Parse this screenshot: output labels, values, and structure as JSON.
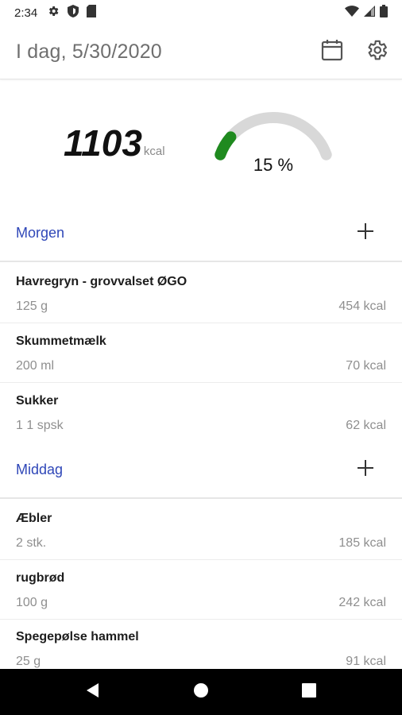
{
  "status_bar": {
    "time": "2:34",
    "left_icons": [
      "gear-icon",
      "shield-icon",
      "sd-card-icon"
    ],
    "right_icons": [
      "wifi-icon",
      "signal-icon",
      "battery-icon"
    ]
  },
  "app_bar": {
    "title": "I dag, 5/30/2020",
    "actions": [
      "calendar-icon",
      "settings-icon"
    ]
  },
  "summary": {
    "kcal_value": "1103",
    "kcal_unit": "kcal",
    "progress_label": "15 %",
    "progress_fraction": 0.15,
    "colors": {
      "progress": "#1f8a1f",
      "track": "#d8d8d8"
    }
  },
  "meals": [
    {
      "name": "Morgen",
      "items": [
        {
          "name": "Havregryn - grovvalset ØGO",
          "amount": "125 g",
          "kcal": "454 kcal"
        },
        {
          "name": "Skummetmælk",
          "amount": "200 ml",
          "kcal": "70 kcal"
        },
        {
          "name": "Sukker",
          "amount": "1 1 spsk",
          "kcal": "62 kcal"
        }
      ]
    },
    {
      "name": "Middag",
      "items": [
        {
          "name": "Æbler",
          "amount": "2 stk.",
          "kcal": "185 kcal"
        },
        {
          "name": "rugbrød",
          "amount": "100 g",
          "kcal": "242 kcal"
        },
        {
          "name": "Spegepølse hammel",
          "amount": "25 g",
          "kcal": "91 kcal"
        }
      ]
    }
  ],
  "nav_bar": {
    "buttons": [
      "back-icon",
      "home-icon",
      "recents-icon"
    ]
  },
  "colors": {
    "section_title": "#2f47b8",
    "nav_bar": "#000000"
  }
}
